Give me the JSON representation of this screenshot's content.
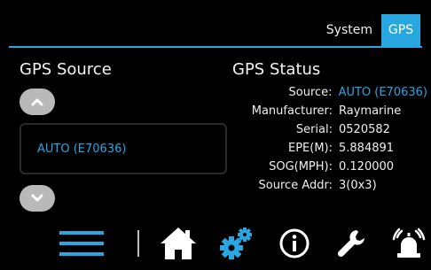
{
  "tabs": [
    {
      "label": "System",
      "active": false
    },
    {
      "label": "GPS",
      "active": true
    }
  ],
  "colors": {
    "accent": "#28a7e0",
    "background": "#000000",
    "text": "#f0f0f0",
    "button_gray": "#b9b9b9"
  },
  "gps_source": {
    "title": "GPS Source",
    "selected": "AUTO (E70636)"
  },
  "gps_status": {
    "title": "GPS Status",
    "rows": [
      {
        "label": "Source:",
        "value": "AUTO (E70636)"
      },
      {
        "label": "Manufacturer:",
        "value": "Raymarine"
      },
      {
        "label": "Serial:",
        "value": "0520582"
      },
      {
        "label": "EPE(M):",
        "value": "5.884891"
      },
      {
        "label": "SOG(MPH):",
        "value": "0.120000"
      },
      {
        "label": "Source Addr:",
        "value": "3(0x3)"
      }
    ]
  },
  "nav": {
    "icons": [
      "menu-icon",
      "home-icon",
      "settings-icon",
      "info-icon",
      "wrench-icon",
      "alarm-icon"
    ],
    "active": "settings-icon"
  }
}
